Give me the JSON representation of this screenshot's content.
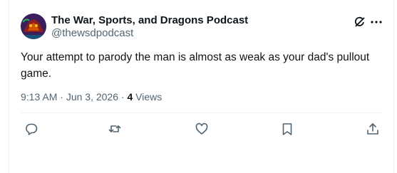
{
  "tweet": {
    "author": {
      "name": "The War, Sports, and Dragons Podcast",
      "handle": "@thewsdpodcast"
    },
    "text": "Your attempt to parody the man is almost as weak as your dad's pullout game.",
    "time": "9:13 AM",
    "date": "Jun 3, 2026",
    "views_count": "4",
    "views_label": "Views"
  },
  "icons": {
    "grok": "grok-icon",
    "more": "more-icon",
    "reply": "reply-icon",
    "retweet": "retweet-icon",
    "like": "heart-icon",
    "bookmark": "bookmark-icon",
    "share": "share-icon"
  },
  "colors": {
    "text": "#0f1419",
    "secondary": "#536471",
    "divider": "#eff3f4"
  }
}
